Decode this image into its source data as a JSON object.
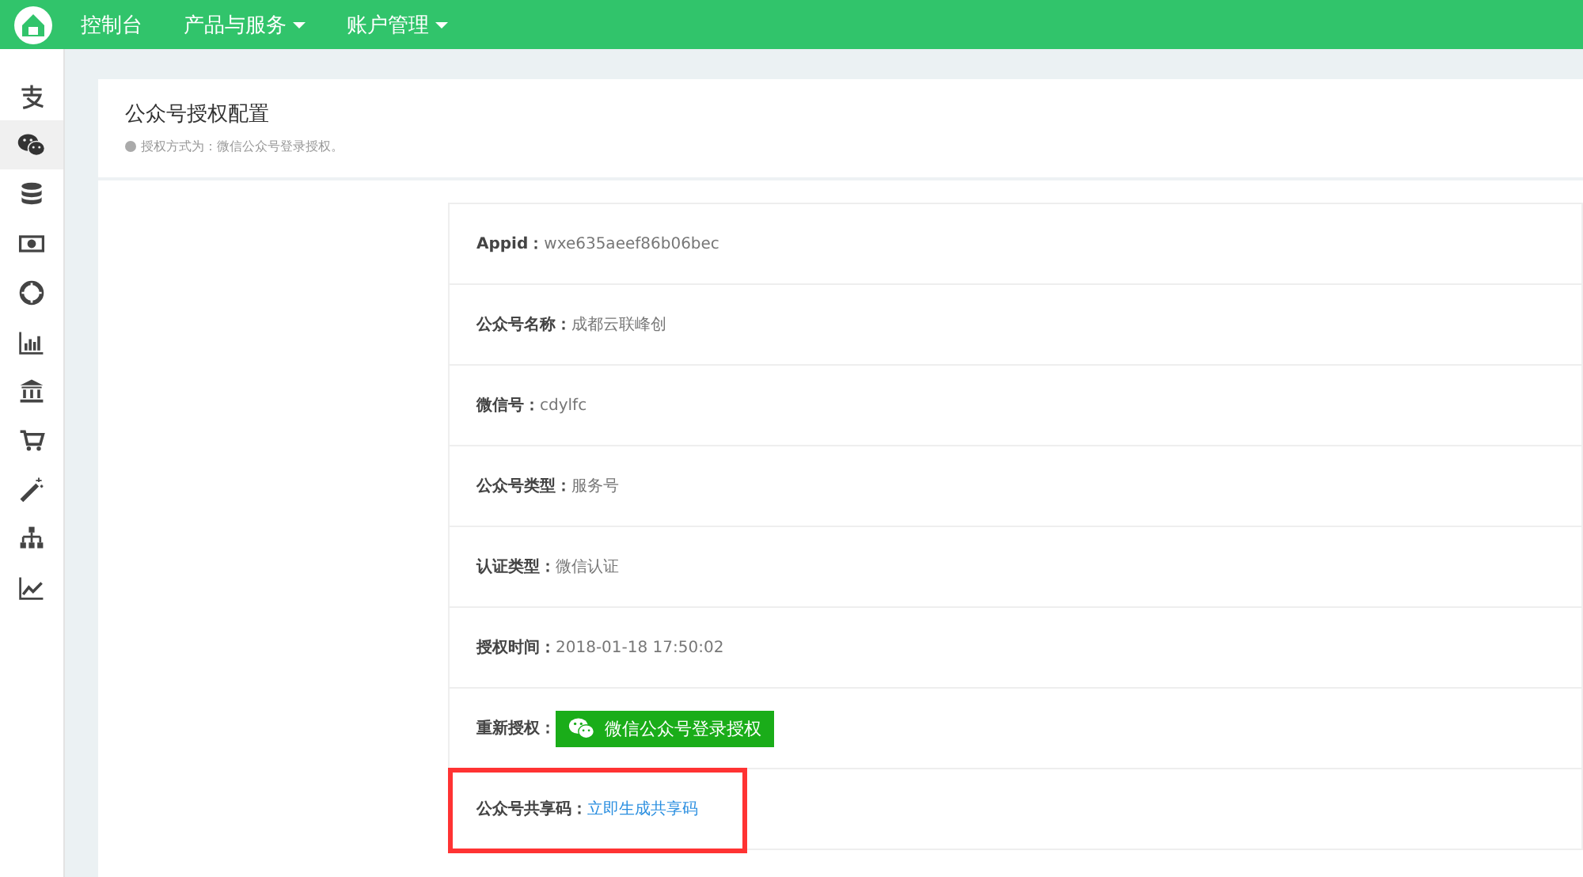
{
  "topbar": {
    "nav": [
      {
        "label": "控制台",
        "dropdown": false
      },
      {
        "label": "产品与服务",
        "dropdown": true
      },
      {
        "label": "账户管理",
        "dropdown": true
      }
    ]
  },
  "sidebar": {
    "items": [
      {
        "selected": false
      },
      {
        "selected": true
      },
      {
        "selected": false
      },
      {
        "selected": false
      },
      {
        "selected": false
      },
      {
        "selected": false
      },
      {
        "selected": false
      },
      {
        "selected": false
      },
      {
        "selected": false
      },
      {
        "selected": false
      },
      {
        "selected": false
      }
    ]
  },
  "card": {
    "title": "公众号授权配置",
    "hint": "授权方式为：微信公众号登录授权。",
    "rows": [
      {
        "kind": "text",
        "label": "Appid：",
        "value": "wxe635aeef86b06bec",
        "highlighted": false
      },
      {
        "kind": "text",
        "label": "公众号名称：",
        "value": "成都云联峰创",
        "highlighted": false
      },
      {
        "kind": "text",
        "label": "微信号：",
        "value": "cdylfc",
        "highlighted": false
      },
      {
        "kind": "text",
        "label": "公众号类型：",
        "value": "服务号",
        "highlighted": false
      },
      {
        "kind": "text",
        "label": "认证类型：",
        "value": "微信认证",
        "highlighted": false
      },
      {
        "kind": "text",
        "label": "授权时间：",
        "value": "2018-01-18 17:50:02",
        "highlighted": false
      },
      {
        "kind": "button",
        "label": "重新授权：",
        "value": "微信公众号登录授权",
        "highlighted": false
      },
      {
        "kind": "link",
        "label": "公众号共享码：",
        "value": "立即生成共享码",
        "highlighted": true
      }
    ]
  }
}
